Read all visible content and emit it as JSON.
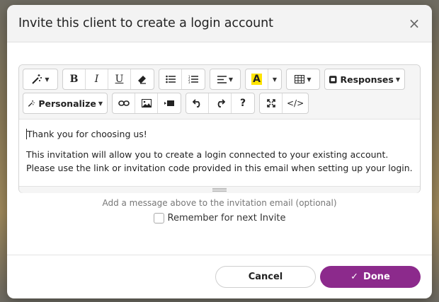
{
  "modal": {
    "title": "Invite this client to create a login account",
    "close_icon": "×"
  },
  "toolbar": {
    "style_icon": "magic-wand-icon",
    "bold": "B",
    "italic": "I",
    "underline": "U",
    "eraser_icon": "eraser-icon",
    "unordered_list_icon": "unordered-list-icon",
    "ordered_list_icon": "ordered-list-icon",
    "align_icon": "align-left-icon",
    "highlight": "A",
    "highlight_color": "#ffe400",
    "table_icon": "table-icon",
    "responses_label": "Responses",
    "personalize_label": "Personalize",
    "link_icon": "link-icon",
    "image_icon": "image-icon",
    "video_icon": "video-icon",
    "undo_icon": "undo-icon",
    "redo_icon": "redo-icon",
    "help": "?",
    "fullscreen_icon": "fullscreen-icon",
    "code": "</>"
  },
  "editor": {
    "paragraphs": [
      "Thank you for choosing us!",
      "This invitation will allow you to create a login connected to your existing account. Please use the link or invitation code provided in this email when setting up your login."
    ]
  },
  "hint": "Add a message above to the invitation email (optional)",
  "remember_label": "Remember for next Invite",
  "remember_checked": false,
  "footer": {
    "cancel_label": "Cancel",
    "done_label": "Done",
    "done_color": "#8c2a8c"
  }
}
